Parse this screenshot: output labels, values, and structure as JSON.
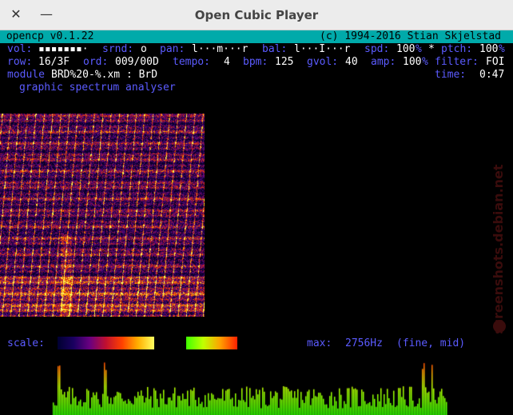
{
  "window": {
    "title": "Open Cubic Player",
    "close_glyph": "✕",
    "minimize_glyph": "—"
  },
  "header": {
    "app": " opencp v0.1.22",
    "copyright": "(c) 1994-2016 Stian Skjelstad"
  },
  "status1": {
    "vol_label": "vol:",
    "vol_value": "▪▪▪▪▪▪▪·",
    "srnd_label": "srnd:",
    "srnd_value": "o",
    "pan_label": "pan:",
    "pan_value": "l···m···r",
    "bal_label": "bal:",
    "bal_value": "l···I···r",
    "spd_label": "spd:",
    "spd_value": "100",
    "pct1": "%",
    "star": "*",
    "ptch_label": "ptch:",
    "ptch_value": "100",
    "pct2": "%"
  },
  "status2": {
    "row_label": "row:",
    "row_value": "16/3F",
    "ord_label": "ord:",
    "ord_value": "009/00D",
    "tempo_label": "tempo:",
    "tempo_value": "4",
    "bpm_label": "bpm:",
    "bpm_value": "125",
    "gvol_label": "gvol:",
    "gvol_value": "40",
    "amp_label": "amp:",
    "amp_value": "100",
    "amp_pct": "%",
    "filter_label": "filter:",
    "filter_value": "FOI"
  },
  "status3": {
    "module_label": "module",
    "module_value": "BRD%20-%.xm : BrD",
    "time_label": "time:",
    "time_value": "0:47"
  },
  "mode_title": "graphic spectrum analyser",
  "scale": {
    "label": "scale:",
    "max_label": "max:",
    "max_value": "2756Hz",
    "mode": "(fine, mid)"
  },
  "watermark": "screenshots.debian.net",
  "colors": {
    "header_bg": "#00aaaa",
    "label_blue": "#5b5bff",
    "value_white": "#ffffff",
    "titlebar_bg": "#ececec"
  }
}
